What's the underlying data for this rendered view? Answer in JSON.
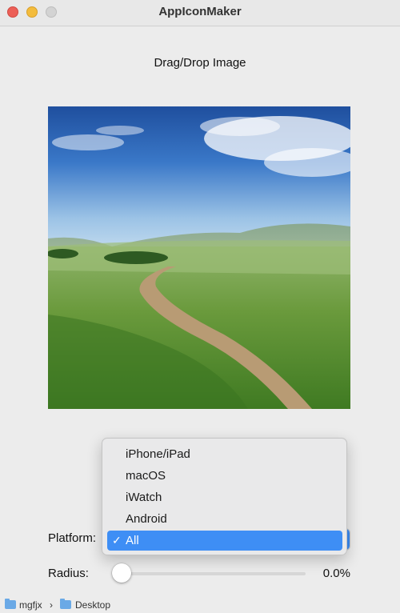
{
  "window": {
    "title": "AppIconMaker"
  },
  "drop_label": "Drag/Drop Image",
  "platform": {
    "label": "Platform:",
    "options": [
      "iPhone/iPad",
      "macOS",
      "iWatch",
      "Android",
      "All"
    ],
    "selected": "All",
    "checkmark": "✓"
  },
  "radius": {
    "label": "Radius:",
    "value_text": "0.0%",
    "value": 0
  },
  "pathbar": {
    "items": [
      "mgfjx",
      "Desktop"
    ],
    "separator": "›"
  },
  "colors": {
    "accent": "#3e8ef5",
    "close": "#ec5f57",
    "minimize": "#f3bc3d"
  }
}
